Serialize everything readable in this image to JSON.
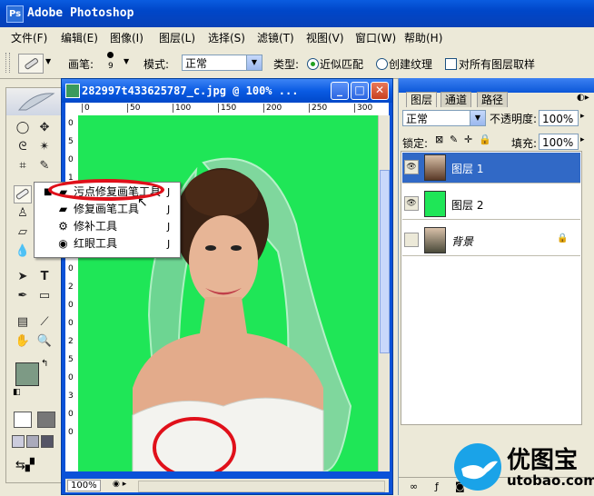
{
  "app": {
    "title": "Adobe Photoshop",
    "icon": "photoshop-app-icon"
  },
  "menu": [
    "文件(F)",
    "编辑(E)",
    "图像(I)",
    "图层(L)",
    "选择(S)",
    "滤镜(T)",
    "视图(V)",
    "窗口(W)",
    "帮助(H)"
  ],
  "options": {
    "brush_label": "画笔:",
    "brush_size": "9",
    "mode_label": "模式:",
    "mode_value": "正常",
    "type_label": "类型:",
    "type_options": [
      {
        "label": "近似匹配",
        "selected": true
      },
      {
        "label": "创建纹理",
        "selected": false
      }
    ],
    "sample_all_label": "对所有图层取样",
    "sample_all_checked": false
  },
  "document": {
    "title": "282997t433625787_c.jpg @ 100% ...",
    "zoom": "100%",
    "ruler_top": [
      "0",
      "50",
      "100",
      "150",
      "200",
      "250",
      "300"
    ],
    "ruler_left": [
      "0",
      "5",
      "0",
      "1",
      "0",
      "0",
      "1",
      "5",
      "0",
      "2",
      "0",
      "0",
      "2",
      "5",
      "0",
      "3",
      "0",
      "0"
    ],
    "canvas_color": "#1fe657"
  },
  "flyout": {
    "items": [
      {
        "label": "污点修复画笔工具",
        "key": "J",
        "icon": "spot-healing-brush-icon",
        "active": true
      },
      {
        "label": "修复画笔工具",
        "key": "J",
        "icon": "healing-brush-icon",
        "active": false
      },
      {
        "label": "修补工具",
        "key": "J",
        "icon": "patch-tool-icon",
        "active": false
      },
      {
        "label": "红眼工具",
        "key": "J",
        "icon": "red-eye-tool-icon",
        "active": false
      }
    ]
  },
  "layers_panel": {
    "tabs": [
      "图层",
      "通道",
      "路径"
    ],
    "blend_mode": "正常",
    "opacity_label": "不透明度:",
    "opacity": "100%",
    "lock_label": "锁定:",
    "fill_label": "填充:",
    "fill": "100%",
    "layers": [
      {
        "name": "图层 1",
        "visible": true,
        "selected": true,
        "thumb": "photo"
      },
      {
        "name": "图层 2",
        "visible": true,
        "selected": false,
        "thumb": "green"
      },
      {
        "name": "背景",
        "visible": false,
        "selected": false,
        "thumb": "photo",
        "locked": true
      }
    ]
  },
  "watermark": {
    "brand": "优图宝",
    "url": "utobao.com"
  },
  "colors": {
    "accent_red": "#e0101a",
    "xp_blue": "#0a5ce0",
    "selected_layer": "#3169c6"
  }
}
